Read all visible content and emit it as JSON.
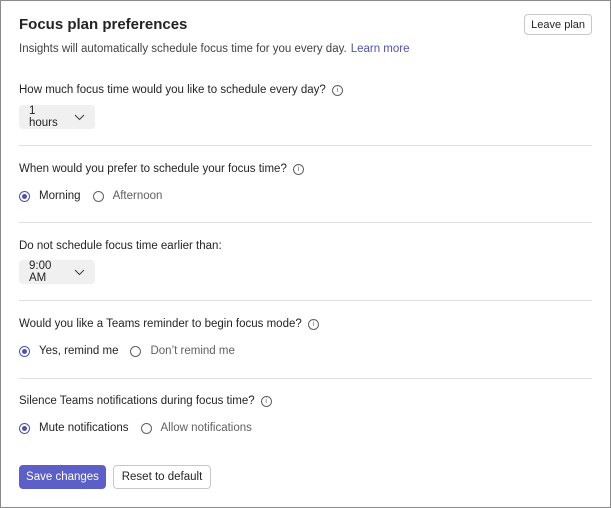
{
  "header": {
    "title": "Focus plan preferences",
    "leave_label": "Leave plan",
    "subtitle": "Insights will automatically schedule focus time for you every day.",
    "learn_more": "Learn more"
  },
  "sections": {
    "duration": {
      "question": "How much focus time would you like to schedule every day?",
      "info": "i",
      "value": "1 hours"
    },
    "time_pref": {
      "question": "When would you prefer to schedule your focus time?",
      "info": "i",
      "options": [
        "Morning",
        "Afternoon"
      ],
      "selected": "Morning"
    },
    "earliest": {
      "question": "Do not schedule focus time earlier than:",
      "value": "9:00 AM"
    },
    "reminder": {
      "question": "Would you like a Teams reminder to begin focus mode?",
      "info": "i",
      "options": [
        "Yes, remind me",
        "Don’t remind me"
      ],
      "selected": "Yes, remind me"
    },
    "silence": {
      "question": "Silence Teams notifications during focus time?",
      "info": "i",
      "options": [
        "Mute notifications",
        "Allow notifications"
      ],
      "selected": "Mute notifications"
    }
  },
  "footer": {
    "save_label": "Save changes",
    "reset_label": "Reset to default"
  },
  "colors": {
    "accent": "#5b5fc7",
    "link": "#4f52b2"
  },
  "icons": {
    "info": "info-icon",
    "dropdown": "chevron-down-icon"
  }
}
